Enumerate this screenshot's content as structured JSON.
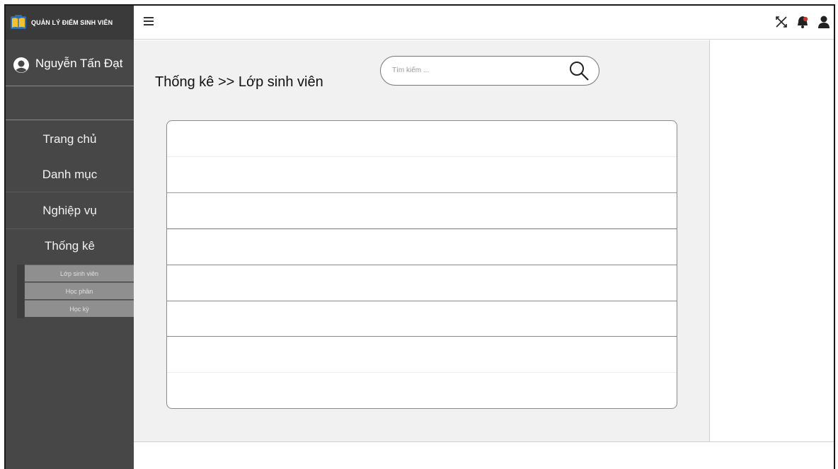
{
  "app": {
    "title": "QUẢN LÝ ĐIỂM SINH VIÊN",
    "logo_icon": "book-logo-icon"
  },
  "user": {
    "name": "Nguyễn Tấn Đạt",
    "avatar_icon": "user-avatar-icon"
  },
  "sidebar": {
    "items": [
      {
        "label": "Trang chủ"
      },
      {
        "label": "Danh mục"
      },
      {
        "label": "Nghiệp vụ"
      },
      {
        "label": "Thống kê"
      }
    ],
    "sub_items": [
      {
        "label": "Lớp sinh viên"
      },
      {
        "label": "Học phần"
      },
      {
        "label": "Học kỳ"
      }
    ]
  },
  "topbar": {
    "menu_icon": "hamburger-menu-icon",
    "icons": [
      "close-x-icon",
      "notification-bell-icon",
      "user-icon"
    ]
  },
  "main": {
    "breadcrumb": "Thống kê >> Lớp sinh viên",
    "search": {
      "placeholder": "Tìm kiếm ...",
      "value": ""
    },
    "table": {
      "rows": [
        "",
        "",
        "",
        "",
        "",
        "",
        "",
        ""
      ]
    }
  },
  "colors": {
    "sidebar_bg": "#474747",
    "main_bg": "#f0f1f0",
    "submenu_bg": "#8f8f8f",
    "notification_dot": "#c0392b"
  }
}
